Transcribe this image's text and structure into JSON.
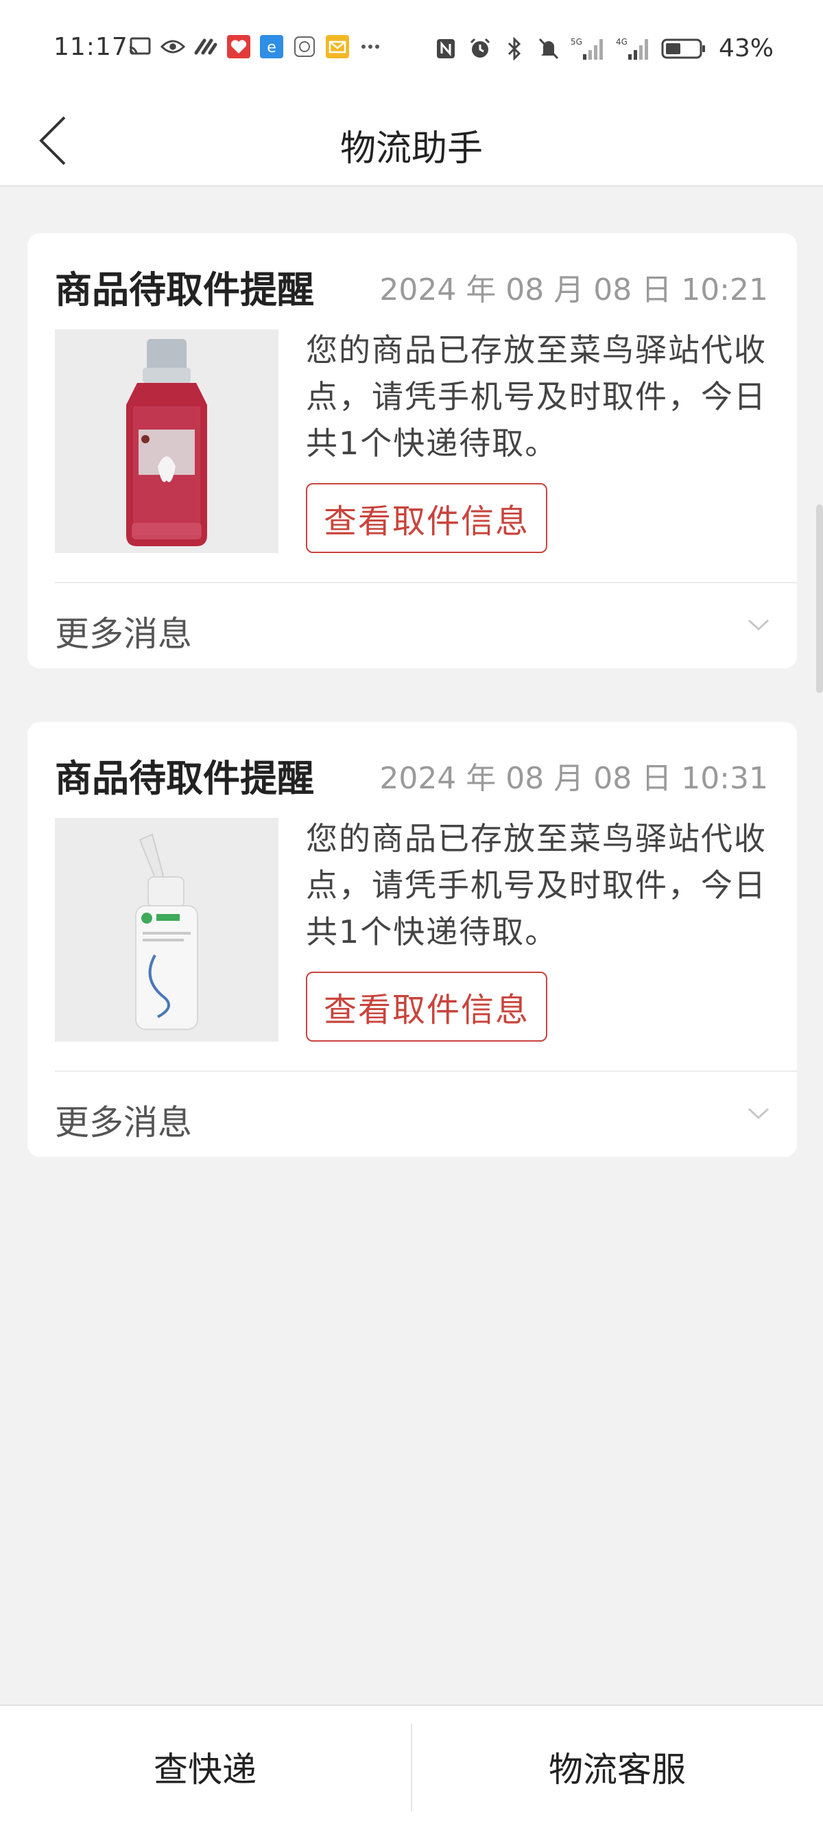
{
  "status_bar": {
    "time": "11:17",
    "battery": "43%",
    "signal1": "5G",
    "signal2": "4G",
    "icons_left": [
      "cast-icon",
      "eye-icon",
      "link-icon",
      "app-heart-icon",
      "app-e-icon",
      "app-circle-icon",
      "mail-icon",
      "more-dots-icon"
    ],
    "icons_right": [
      "nfc-icon",
      "alarm-icon",
      "bluetooth-icon",
      "mute-icon",
      "signal-5g-icon",
      "signal-4g-icon",
      "battery-icon"
    ]
  },
  "header": {
    "title": "物流助手"
  },
  "cards": [
    {
      "title": "商品待取件提醒",
      "time": "2024 年 08 月 08 日 10:21",
      "message": "您的商品已存放至菜鸟驿站代收点，请凭手机号及时取件，今日共1个快递待取。",
      "button": "查看取件信息",
      "more": "更多消息",
      "product": "mouthwash-bottle"
    },
    {
      "title": "商品待取件提醒",
      "time": "2024 年 08 月 08 日 10:31",
      "message": "您的商品已存放至菜鸟驿站代收点，请凭手机号及时取件，今日共1个快递待取。",
      "button": "查看取件信息",
      "more": "更多消息",
      "product": "nasal-spray-bottle"
    }
  ],
  "bottom": {
    "left": "查快递",
    "right": "物流客服"
  },
  "colors": {
    "accent": "#c9443c",
    "background": "#f2f2f2",
    "card": "#ffffff",
    "muted_text": "#9a9a9a"
  }
}
